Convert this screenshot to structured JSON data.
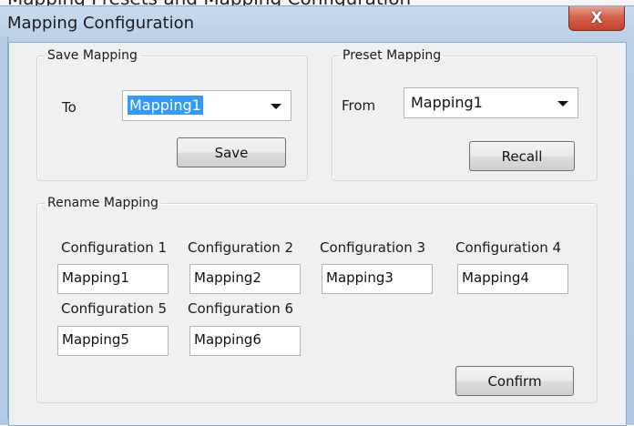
{
  "background_text": "Mapping Presets and Mapping Configuration",
  "window": {
    "title": "Mapping Configuration",
    "close_glyph": "X",
    "close_icon": "close-icon"
  },
  "save_mapping": {
    "legend": "Save Mapping",
    "to_label": "To",
    "selected": "Mapping1",
    "save_label": "Save"
  },
  "preset_mapping": {
    "legend": "Preset Mapping",
    "from_label": "From",
    "selected": "Mapping1",
    "recall_label": "Recall"
  },
  "rename_mapping": {
    "legend": "Rename Mapping",
    "configs": [
      {
        "label": "Configuration 1",
        "value": "Mapping1"
      },
      {
        "label": "Configuration 2",
        "value": "Mapping2"
      },
      {
        "label": "Configuration 3",
        "value": "Mapping3"
      },
      {
        "label": "Configuration 4",
        "value": "Mapping4"
      },
      {
        "label": "Configuration 5",
        "value": "Mapping5"
      },
      {
        "label": "Configuration 6",
        "value": "Mapping6"
      }
    ],
    "confirm_label": "Confirm"
  }
}
